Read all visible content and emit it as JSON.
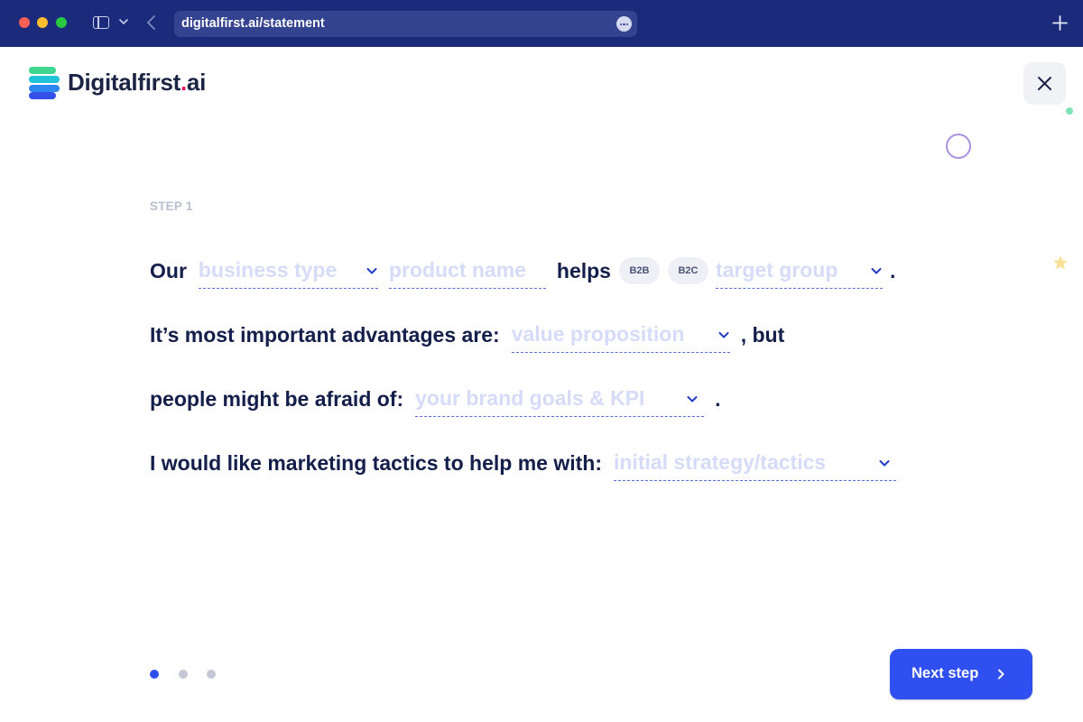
{
  "browser": {
    "url": "digitalfirst.ai/statement"
  },
  "brand": {
    "name_main": "Digitalfirst",
    "name_dot": ".",
    "name_tld": "ai"
  },
  "step_label": "STEP 1",
  "statement": {
    "line1": {
      "prefix": "Our",
      "business_type_placeholder": "business type",
      "product_name_placeholder": "product name",
      "verb": "helps",
      "pill_b2b": "B2B",
      "pill_b2c": "B2C",
      "target_group_placeholder": "target group",
      "end": "."
    },
    "line2": {
      "prefix": "It’s most important advantages are:",
      "value_proposition_placeholder": "value proposition",
      "suffix": ", but"
    },
    "line3": {
      "prefix": "people might be afraid of:",
      "brand_goals_placeholder": "your brand goals & KPI",
      "end": "."
    },
    "line4": {
      "prefix": "I would like marketing tactics to help me with:",
      "tactics_placeholder": "initial strategy/tactics"
    }
  },
  "pagination": {
    "current_step": 1,
    "total_steps": 3,
    "active_color": "#2f4ff0",
    "inactive_color": "#c3c7d6"
  },
  "next_button": {
    "label": "Next step"
  },
  "colors": {
    "chrome": "#1b2a7a",
    "accent": "#2f4ff0",
    "text": "#141e4a",
    "placeholder": "#d6dcf7"
  }
}
